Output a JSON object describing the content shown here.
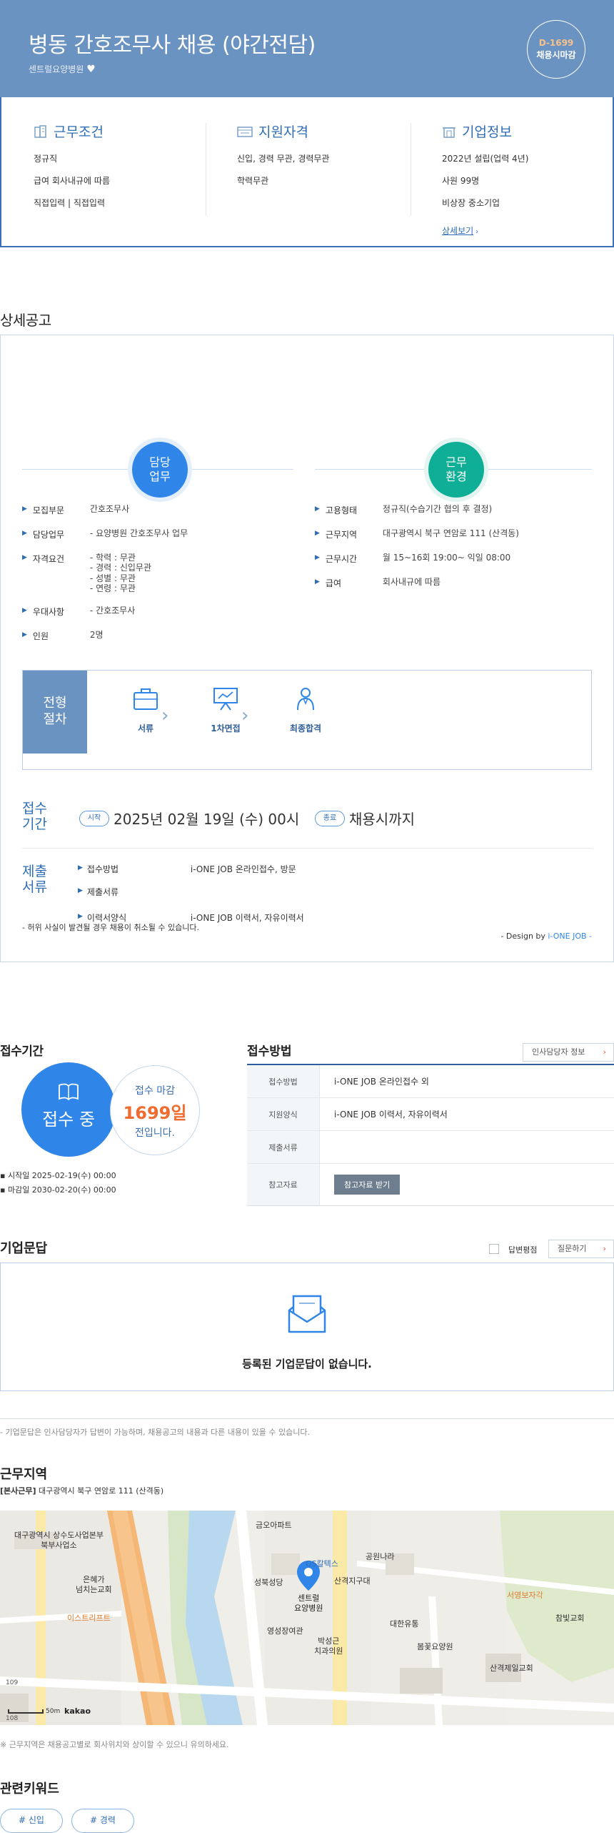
{
  "header": {
    "title": "병동 간호조무사 채용 (야간전담)",
    "company": "센트럴요양병원",
    "heart_icon": "heart-icon",
    "dday": "D-1699",
    "dday_label": "채용시마감",
    "colors": {
      "banner": "#6b93c1",
      "dday": "#f7c28d"
    }
  },
  "summary": {
    "conditions": {
      "title": "근무조건",
      "lines": [
        "정규직",
        "급여 회사내규에 따름",
        "직접입력 | 직접입력"
      ]
    },
    "qualifications": {
      "title": "지원자격",
      "lines": [
        "신입, 경력 무관, 경력무관",
        "학력무관"
      ]
    },
    "company": {
      "title": "기업정보",
      "lines": [
        "2022년 설립(업력 4년)",
        "사원 99명",
        "비상장 중소기업"
      ],
      "link": "상세보기"
    }
  },
  "detail": {
    "section_title": "상세공고",
    "duty_bubble": "담당\n업무",
    "env_bubble": "근무\n환경",
    "left_rows": [
      {
        "k": "모집부문",
        "v": "간호조무사"
      },
      {
        "k": "담당업무",
        "v": "- 요양병원 간호조무사 업무"
      },
      {
        "k": "자격요건",
        "v": "- 학력 : 무관\n- 경력 : 신입무관\n- 성별 : 무관\n- 연령 : 무관"
      },
      {
        "k": "우대사항",
        "v": "- 간호조무사"
      },
      {
        "k": "인원",
        "v": "2명"
      }
    ],
    "right_rows": [
      {
        "k": "고용형태",
        "v": "정규직(수습기간 협의 후 결정)"
      },
      {
        "k": "근무지역",
        "v": "대구광역시 북구 연암로 111 (산격동)"
      },
      {
        "k": "근무시간",
        "v": "월 15~16회 19:00~ 익일 08:00"
      },
      {
        "k": "급여",
        "v": "회사내규에 따름"
      }
    ],
    "process_label": "전형\n절차",
    "steps": [
      "서류",
      "1차면접",
      "최종합격"
    ],
    "period_label": "접수\n기간",
    "start_pill": "시작",
    "start_text": "2025년 02월 19일 (수) 00시",
    "end_pill": "종료",
    "end_text": "채용시까지",
    "docs_label": "제출\n서류",
    "doc_rows": [
      {
        "k": "접수방법",
        "v": "i-ONE JOB 온라인접수, 방문"
      },
      {
        "k": "제출서류",
        "v": ""
      },
      {
        "k": "이력서양식",
        "v": "i-ONE JOB 이력서, 자유이력서"
      }
    ],
    "warning": "- 허위 사실이 발견될 경우 채용이 취소될 수 있습니다.",
    "design_by": "- Design by",
    "design_brand": "i-ONE JOB -"
  },
  "apply": {
    "title": "접수기간",
    "status": "접수 중",
    "deadline_label": "접수 마감",
    "days": "1699일",
    "days_suffix": "전입니다.",
    "start": "시작일 2025-02-19(수) 00:00",
    "end": "마감일 2030-02-20(수) 00:00"
  },
  "method": {
    "title": "접수방법",
    "hr_button": "인사담당자 정보",
    "rows": [
      {
        "k": "접수방법",
        "v": "i-ONE JOB 온라인접수 외"
      },
      {
        "k": "지원양식",
        "v": "i-ONE JOB 이력서, 자유이력서"
      },
      {
        "k": "제출서류",
        "v": ""
      },
      {
        "k": "참고자료",
        "v": ""
      }
    ],
    "ref_button": "참고자료 받기"
  },
  "qna": {
    "title": "기업문답",
    "checkbox_label": "답변평점",
    "ask_button": "질문하기",
    "empty": "등록된 기업문답이 없습니다.",
    "note": "- 기업문답은 인사담당자가 답변이 가능하며, 채용공고의 내용과 다른 내용이 있을 수 있습니다."
  },
  "location": {
    "title": "근무지역",
    "addr_tag": "[본사근무]",
    "addr": "대구광역시 북구 연암로 111 (산격동)",
    "map_labels": [
      "대구광역시 상수도사업본부\n북부사업소",
      "금오아파트",
      "GS칼텍스",
      "공원나라",
      "성북성당",
      "산격지구대",
      "센트럴\n요양병원",
      "은혜가\n넘치는교회",
      "이스트리프트",
      "영성장여관",
      "대한유통",
      "봄꽃요양원",
      "박성근\n치과의원",
      "서영보자각",
      "참빛교회",
      "산격제일교회",
      "109",
      "108",
      "50m",
      "kakao"
    ],
    "note": "※ 근무지역은 채용공고별로 회사위치와 상이할 수 있으니 유의하세요."
  },
  "keywords": {
    "title": "관련키워드",
    "items": [
      "# 신입",
      "# 경력"
    ]
  }
}
